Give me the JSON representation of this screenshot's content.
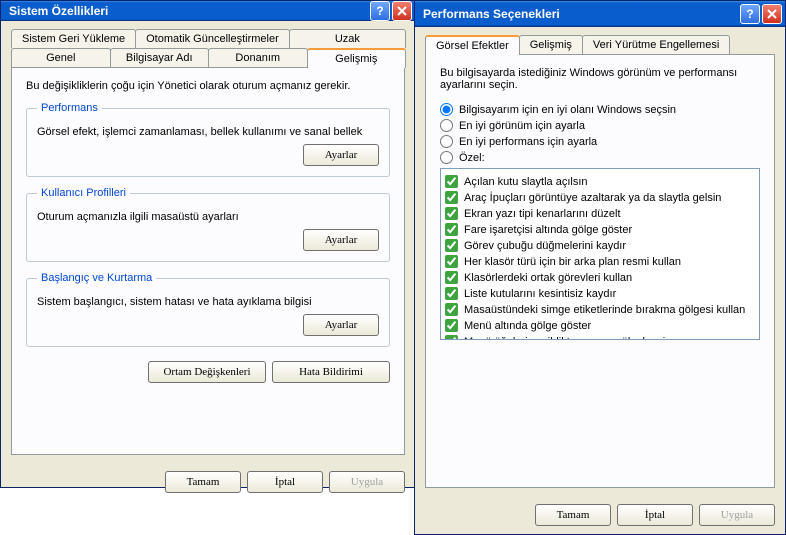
{
  "window1": {
    "title": "Sistem Özellikleri",
    "tabsRow1": [
      "Sistem Geri Yükleme",
      "Otomatik Güncelleştirmeler",
      "Uzak"
    ],
    "tabsRow2": [
      "Genel",
      "Bilgisayar Adı",
      "Donanım",
      "Gelişmiş"
    ],
    "activeTab": "Gelişmiş",
    "intro": "Bu değişikliklerin çoğu için Yönetici olarak oturum açmanız gerekir.",
    "perf": {
      "legend": "Performans",
      "desc": "Görsel efekt, işlemci zamanlaması, bellek kullanımı ve sanal bellek",
      "btn": "Ayarlar"
    },
    "profiles": {
      "legend": "Kullanıcı Profilleri",
      "desc": "Oturum açmanızla ilgili masaüstü ayarları",
      "btn": "Ayarlar"
    },
    "startup": {
      "legend": "Başlangıç ve Kurtarma",
      "desc": "Sistem başlangıcı, sistem hatası ve hata ayıklama bilgisi",
      "btn": "Ayarlar"
    },
    "envBtn": "Ortam Değişkenleri",
    "errBtn": "Hata Bildirimi",
    "ok": "Tamam",
    "cancel": "İptal",
    "apply": "Uygula"
  },
  "window2": {
    "title": "Performans Seçenekleri",
    "tabs": [
      "Görsel Efektler",
      "Gelişmiş",
      "Veri Yürütme Engellemesi"
    ],
    "activeTab": "Görsel Efektler",
    "intro": "Bu bilgisayarda istediğiniz Windows görünüm ve performansı ayarlarını seçin.",
    "radios": [
      "Bilgisayarım için en iyi olanı Windows seçsin",
      "En iyi görünüm için ayarla",
      "En iyi performans için ayarla",
      "Özel:"
    ],
    "selectedRadio": 0,
    "checks": [
      "Açılan kutu slaytla açılsın",
      "Araç İpuçları görüntüye azaltarak ya da slaytla gelsin",
      "Ekran yazı tipi kenarlarını düzelt",
      "Fare işaretçisi altında gölge göster",
      "Görev çubuğu düğmelerini kaydır",
      "Her klasör türü için bir arka plan resmi kullan",
      "Klasörlerdeki ortak görevleri kullan",
      "Liste kutularını kesintisiz kaydır",
      "Masaüstündeki simge etiketlerinde bırakma gölgesi kullan",
      "Menü altında gölge göster",
      "Menü öğeleri seçildikten sonra gölgelensin"
    ],
    "ok": "Tamam",
    "cancel": "İptal",
    "apply": "Uygula"
  }
}
